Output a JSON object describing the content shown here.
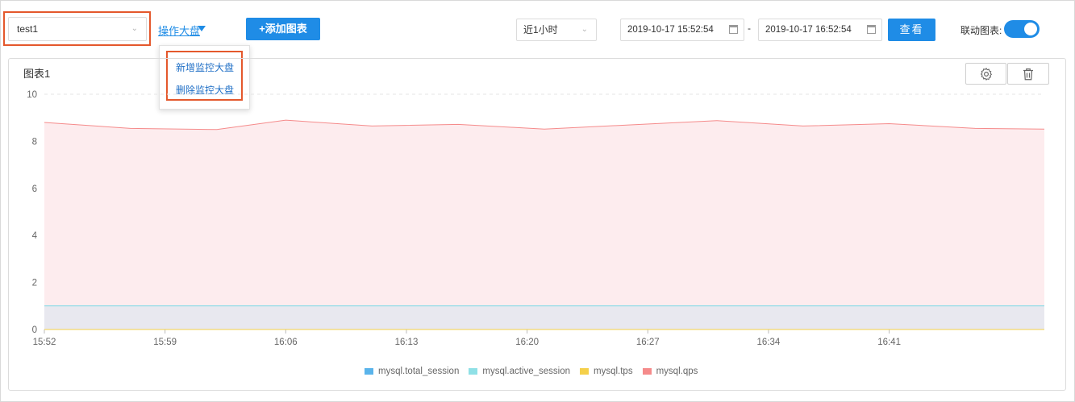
{
  "toolbar": {
    "dashboard_select": "test1",
    "operate_link": "操作大盘",
    "add_chart_button": "+添加图表",
    "time_range": "近1小时",
    "start_time": "2019-10-17 15:52:54",
    "separator": "-",
    "end_time": "2019-10-17 16:52:54",
    "query_button": "查看",
    "link_charts_label": "联动图表:",
    "link_charts_on": true
  },
  "dropdown_menu": {
    "items": [
      "新增监控大盘",
      "删除监控大盘"
    ]
  },
  "chart_card": {
    "title": "图表1",
    "settings_icon": "gear-icon",
    "delete_icon": "trash-icon"
  },
  "colors": {
    "accent": "#1f8ce6",
    "highlight": "#e4582c"
  },
  "chart_data": {
    "type": "area",
    "title": "图表1",
    "xlabel": "",
    "ylabel": "",
    "ylim": [
      0,
      10
    ],
    "y_ticks": [
      "0",
      "2",
      "4",
      "6",
      "8",
      "10"
    ],
    "x_ticks": [
      "15:52",
      "15:59",
      "16:06",
      "16:13",
      "16:20",
      "16:27",
      "16:34",
      "16:41"
    ],
    "x_minutes": [
      0,
      5,
      10,
      14,
      19,
      24,
      29,
      34,
      39,
      44,
      49,
      54,
      58
    ],
    "grid": true,
    "legend_position": "bottom",
    "series": [
      {
        "name": "mysql.total_session",
        "color": "#5ab4eb",
        "values": [
          1,
          1,
          1,
          1,
          1,
          1,
          1,
          1,
          1,
          1,
          1,
          1,
          1
        ]
      },
      {
        "name": "mysql.active_session",
        "color": "#8fe0e6",
        "values": [
          1,
          1,
          1,
          1,
          1,
          1,
          1,
          1,
          1,
          1,
          1,
          1,
          1
        ]
      },
      {
        "name": "mysql.tps",
        "color": "#f5d04a",
        "values": [
          0,
          0,
          0,
          0,
          0,
          0,
          0,
          0,
          0,
          0,
          0,
          0,
          0
        ]
      },
      {
        "name": "mysql.qps",
        "color": "#f58b8b",
        "values": [
          8.8,
          8.55,
          8.5,
          8.9,
          8.65,
          8.72,
          8.52,
          8.7,
          8.88,
          8.65,
          8.75,
          8.55,
          8.52
        ]
      }
    ]
  }
}
